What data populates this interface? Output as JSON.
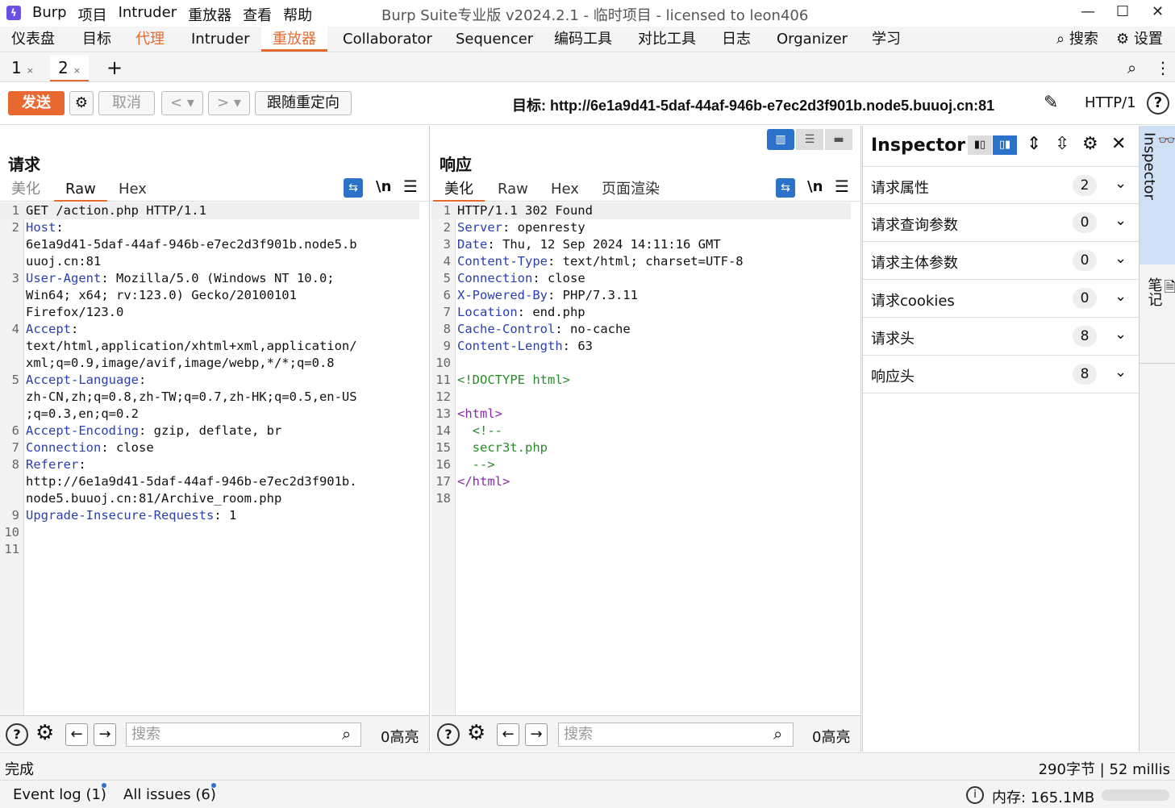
{
  "app": {
    "menu": [
      "Burp",
      "项目",
      "Intruder",
      "重放器",
      "查看",
      "帮助"
    ],
    "window_title": "Burp Suite专业版  v2024.2.1 - 临时项目 - licensed to leon406"
  },
  "main_tabs": [
    "仪表盘",
    "目标",
    "代理",
    "Intruder",
    "重放器",
    "Collaborator",
    "Sequencer",
    "编码工具",
    "对比工具",
    "日志",
    "Organizer",
    "学习"
  ],
  "main_tabs_right": {
    "search": "搜索",
    "settings": "设置"
  },
  "sub_tabs": [
    {
      "label": "1",
      "close": "×"
    },
    {
      "label": "2",
      "close": "×"
    }
  ],
  "toolbar": {
    "send": "发送",
    "cancel": "取消",
    "follow_redirect": "跟随重定向",
    "target": "目标: http://6e1a9d41-5daf-44af-946b-e7ec2d3f901b.node5.buuoj.cn:81",
    "protocol": "HTTP/1"
  },
  "request": {
    "title": "请求",
    "tabs": [
      "美化",
      "Raw",
      "Hex"
    ],
    "nl": "\\n",
    "lines": [
      {
        "n": "1",
        "k": "",
        "v": "GET /action.php HTTP/1.1"
      },
      {
        "n": "2",
        "k": "Host",
        "v": ":"
      },
      {
        "n": "",
        "k": "",
        "v": "6e1a9d41-5daf-44af-946b-e7ec2d3f901b.node5.b"
      },
      {
        "n": "",
        "k": "",
        "v": "uuoj.cn:81"
      },
      {
        "n": "3",
        "k": "User-Agent",
        "v": ": Mozilla/5.0 (Windows NT 10.0;"
      },
      {
        "n": "",
        "k": "",
        "v": "Win64; x64; rv:123.0) Gecko/20100101"
      },
      {
        "n": "",
        "k": "",
        "v": "Firefox/123.0"
      },
      {
        "n": "4",
        "k": "Accept",
        "v": ":"
      },
      {
        "n": "",
        "k": "",
        "v": "text/html,application/xhtml+xml,application/"
      },
      {
        "n": "",
        "k": "",
        "v": "xml;q=0.9,image/avif,image/webp,*/*;q=0.8"
      },
      {
        "n": "5",
        "k": "Accept-Language",
        "v": ":"
      },
      {
        "n": "",
        "k": "",
        "v": "zh-CN,zh;q=0.8,zh-TW;q=0.7,zh-HK;q=0.5,en-US"
      },
      {
        "n": "",
        "k": "",
        "v": ";q=0.3,en;q=0.2"
      },
      {
        "n": "6",
        "k": "Accept-Encoding",
        "v": ": gzip, deflate, br"
      },
      {
        "n": "7",
        "k": "Connection",
        "v": ": close"
      },
      {
        "n": "8",
        "k": "Referer",
        "v": ":"
      },
      {
        "n": "",
        "k": "",
        "v": "http://6e1a9d41-5daf-44af-946b-e7ec2d3f901b."
      },
      {
        "n": "",
        "k": "",
        "v": "node5.buuoj.cn:81/Archive_room.php"
      },
      {
        "n": "9",
        "k": "Upgrade-Insecure-Requests",
        "v": ": 1"
      },
      {
        "n": "10",
        "k": "",
        "v": ""
      },
      {
        "n": "11",
        "k": "",
        "v": ""
      }
    ]
  },
  "response": {
    "title": "响应",
    "tabs": [
      "美化",
      "Raw",
      "Hex",
      "页面渲染"
    ],
    "nl": "\\n",
    "lines": [
      {
        "n": "1",
        "k": "",
        "v": "HTTP/1.1 302 Found",
        "c": ""
      },
      {
        "n": "2",
        "k": "Server",
        "v": ": openresty",
        "c": ""
      },
      {
        "n": "3",
        "k": "Date",
        "v": ": Thu, 12 Sep 2024 14:11:16 GMT",
        "c": ""
      },
      {
        "n": "4",
        "k": "Content-Type",
        "v": ": text/html; charset=UTF-8",
        "c": ""
      },
      {
        "n": "5",
        "k": "Connection",
        "v": ": close",
        "c": ""
      },
      {
        "n": "6",
        "k": "X-Powered-By",
        "v": ": PHP/7.3.11",
        "c": ""
      },
      {
        "n": "7",
        "k": "Location",
        "v": ": end.php",
        "c": ""
      },
      {
        "n": "8",
        "k": "Cache-Control",
        "v": ": no-cache",
        "c": ""
      },
      {
        "n": "9",
        "k": "Content-Length",
        "v": ": 63",
        "c": ""
      },
      {
        "n": "10",
        "k": "",
        "v": "",
        "c": ""
      },
      {
        "n": "11",
        "k": "",
        "v": "<!DOCTYPE html>",
        "c": "cm"
      },
      {
        "n": "12",
        "k": "",
        "v": "",
        "c": ""
      },
      {
        "n": "13",
        "k": "",
        "v": "<html>",
        "c": "tag"
      },
      {
        "n": "14",
        "k": "",
        "v": "  <!--",
        "c": "cm"
      },
      {
        "n": "15",
        "k": "",
        "v": "  secr3t.php",
        "c": "cm"
      },
      {
        "n": "16",
        "k": "",
        "v": "  -->",
        "c": "cm"
      },
      {
        "n": "17",
        "k": "",
        "v": "</html>",
        "c": "tag"
      },
      {
        "n": "18",
        "k": "",
        "v": "",
        "c": ""
      }
    ]
  },
  "search": {
    "placeholder": "搜索",
    "count": "0高亮"
  },
  "inspector": {
    "title": "Inspector",
    "rows": [
      {
        "label": "请求属性",
        "count": "2"
      },
      {
        "label": "请求查询参数",
        "count": "0"
      },
      {
        "label": "请求主体参数",
        "count": "0"
      },
      {
        "label": "请求cookies",
        "count": "0"
      },
      {
        "label": "请求头",
        "count": "8"
      },
      {
        "label": "响应头",
        "count": "8"
      }
    ]
  },
  "sidebar": {
    "inspector": "Inspector",
    "notes": "笔记"
  },
  "status": {
    "left": "完成",
    "right": "290字节 | 52 millis"
  },
  "bottom": {
    "event_log": "Event log (1)",
    "issues": "All issues (6)",
    "memory": "内存: 165.1MB"
  },
  "colors": {
    "accent": "#e8692f",
    "blue": "#2a73c8",
    "key": "#2a3fb0",
    "tag": "#8a2aa8",
    "comment": "#2a8a2a"
  }
}
